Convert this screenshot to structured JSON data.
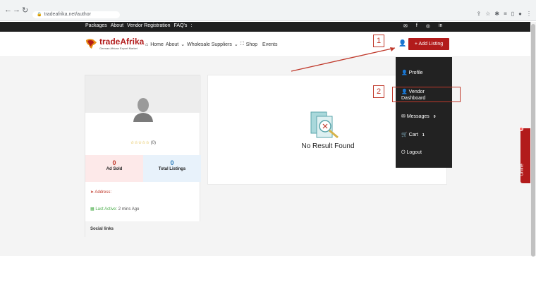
{
  "browser": {
    "url": "tradeafrika.net/author",
    "nav_icons": [
      "back-icon",
      "forward-icon",
      "reload-icon"
    ],
    "toolbar_icons": [
      "share-icon",
      "star-icon",
      "extension-icon",
      "playlist-icon",
      "sidebar-icon",
      "profile-icon",
      "menu-icon"
    ]
  },
  "topbar": {
    "links": [
      "Packages",
      "About",
      "Vendor Registration",
      "FAQ's",
      ":"
    ],
    "social_icons": [
      "mail-icon",
      "facebook-icon",
      "instagram-icon",
      "linkedin-icon"
    ]
  },
  "header": {
    "brand_main": "tradeAfrika",
    "brand_tagline": "German African Export Market",
    "nav": [
      {
        "label": "Home",
        "icon": "home-icon"
      },
      {
        "label": "About",
        "icon": "chevron-down-icon"
      },
      {
        "label": "Wholesale Suppliers",
        "icon": "chevron-down-icon"
      },
      {
        "label": "Shop",
        "icon": "basket-icon"
      },
      {
        "label": "Events",
        "icon": ""
      }
    ],
    "add_listing": "+ Add Listing"
  },
  "dropdown": {
    "items": [
      {
        "label": "Profile",
        "icon": "user-icon",
        "badge": ""
      },
      {
        "label": "Vendor Dashboard",
        "icon": "user-icon",
        "badge": ""
      },
      {
        "label": "Messages",
        "icon": "envelope-icon",
        "badge": "0"
      },
      {
        "label": "Cart",
        "icon": "cart-icon",
        "badge": "1"
      },
      {
        "label": "Logout",
        "icon": "power-icon",
        "badge": ""
      }
    ]
  },
  "profile": {
    "rating_stars": "☆☆☆☆☆",
    "rating_count": "(0)",
    "ad_sold_value": "0",
    "ad_sold_label": "Ad Sold",
    "total_listings_value": "0",
    "total_listings_label": "Total Listings",
    "address_label": "Address:",
    "last_active_label": "Last Active:",
    "last_active_value": "2 mins Ago",
    "social_links_label": "Social links"
  },
  "results": {
    "empty_text": "No Result Found"
  },
  "annotations": {
    "step1": "1",
    "step2": "2"
  },
  "online_tab": "Online",
  "colors": {
    "brand_red": "#b21b1b",
    "dark": "#222222",
    "annotation_red": "#c0392b"
  }
}
